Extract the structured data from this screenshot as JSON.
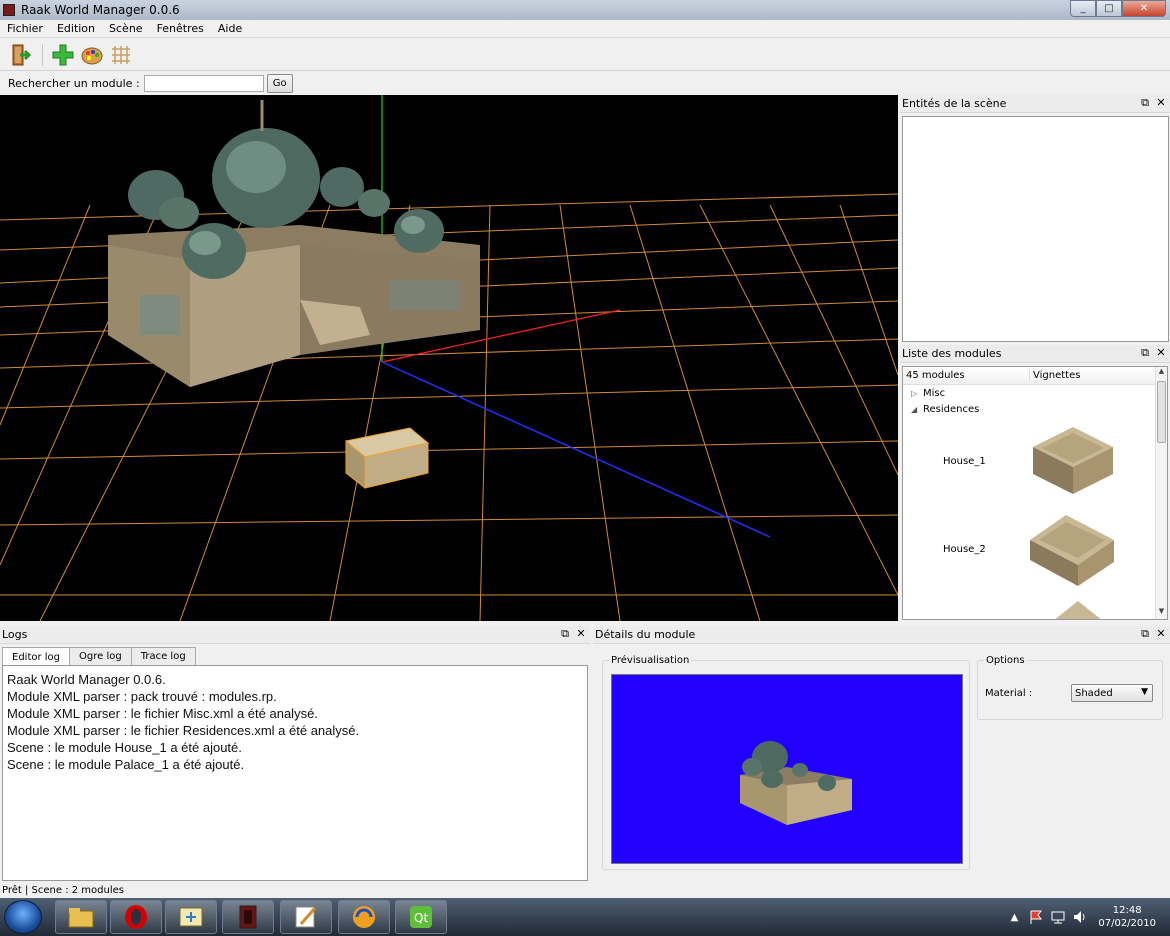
{
  "window": {
    "title": "Raak World Manager 0.0.6",
    "min": "_",
    "max": "□",
    "close": "✕"
  },
  "menu": [
    "Fichier",
    "Edition",
    "Scène",
    "Fenêtres",
    "Aide"
  ],
  "toolbar": {
    "items": [
      "exit-door-icon",
      "add-plus-icon",
      "palette-icon",
      "grid-icon"
    ]
  },
  "search": {
    "label": "Rechercher un module :",
    "value": "",
    "placeholder": "",
    "go": "Go"
  },
  "entities": {
    "title": "Entités de la scène"
  },
  "modules": {
    "title": "Liste des modules",
    "header_count": "45 modules",
    "header_thumbs": "Vignettes",
    "tree": [
      {
        "label": "Misc",
        "expanded": false
      },
      {
        "label": "Residences",
        "expanded": true
      }
    ],
    "items": [
      "House_1",
      "House_2"
    ]
  },
  "logs": {
    "title": "Logs",
    "tabs": [
      "Editor log",
      "Ogre log",
      "Trace log"
    ],
    "lines": [
      "Raak World Manager 0.0.6.",
      "Module XML parser : pack trouvé : modules.rp.",
      "Module XML parser : le fichier Misc.xml a été analysé.",
      "Module XML parser : le fichier Residences.xml a été analysé.",
      "Scene : le module House_1 a été ajouté.",
      "Scene : le module Palace_1 a été ajouté."
    ]
  },
  "details": {
    "title": "Détails du module",
    "preview_label": "Prévisualisation",
    "options_label": "Options",
    "material_label": "Material :",
    "material_value": "Shaded",
    "preview_bg": "#2200ff"
  },
  "dock_btns": {
    "float": "⧉",
    "close": "✕"
  },
  "status": "Prêt | Scene : 2 modules",
  "taskbar": {
    "apps": [
      "explorer-icon",
      "opera-icon",
      "app-icon",
      "raak-icon",
      "notepad-icon",
      "audio-icon",
      "qt-icon"
    ],
    "time": "12:48",
    "date": "07/02/2010"
  },
  "colors": {
    "grid": "#e89a3c",
    "axis_x": "#ff2020",
    "axis_y": "#20d020",
    "axis_z": "#2030ff"
  }
}
